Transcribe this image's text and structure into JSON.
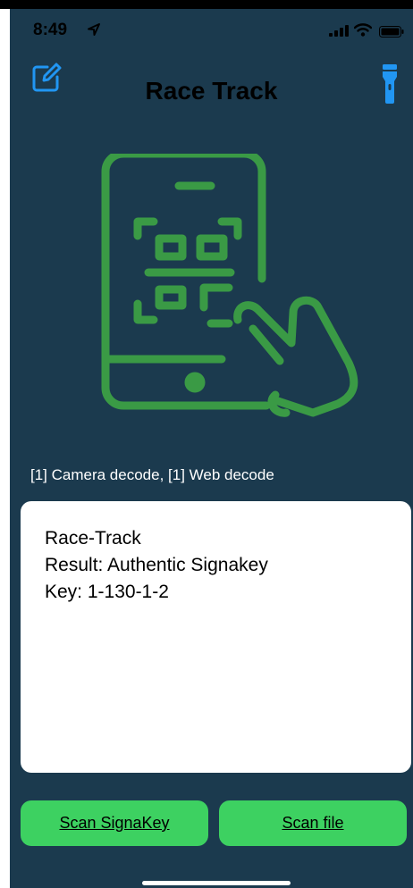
{
  "status_bar": {
    "time": "8:49",
    "icons": [
      "location-arrow-icon",
      "cellular-signal-icon",
      "wifi-icon",
      "battery-icon"
    ]
  },
  "header": {
    "title": "Race Track",
    "left_icon": "edit-icon",
    "right_icon": "flashlight-icon"
  },
  "hero": {
    "icon": "phone-qr-scan-icon"
  },
  "decode_counts": "[1] Camera decode, [1] Web decode",
  "result": {
    "lines": [
      "Race-Track",
      "Result: Authentic Signakey",
      "Key: 1-130-1-2"
    ]
  },
  "buttons": {
    "scan_signakey": "Scan SignaKey",
    "scan_file": "Scan file"
  },
  "colors": {
    "background": "#1b3a4e",
    "accent_blue": "#2196f3",
    "icon_green": "#3a9a45",
    "button_green": "#3dd161"
  }
}
